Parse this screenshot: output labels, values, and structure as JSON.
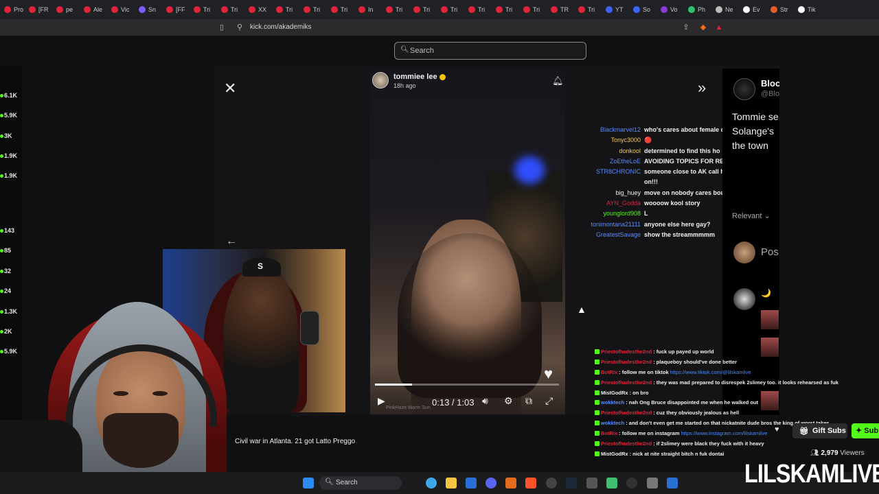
{
  "browser": {
    "tabs": [
      {
        "label": "Pro",
        "color": "#e0243a"
      },
      {
        "label": "[FR",
        "color": "#e0243a"
      },
      {
        "label": "pe",
        "color": "#e0243a"
      },
      {
        "label": "Ale",
        "color": "#e0243a"
      },
      {
        "label": "Vic",
        "color": "#e0243a"
      },
      {
        "label": "Sn",
        "color": "#7d5cff"
      },
      {
        "label": "[FF",
        "color": "#e0243a"
      },
      {
        "label": "Tri",
        "color": "#e0243a"
      },
      {
        "label": "Tri",
        "color": "#e0243a"
      },
      {
        "label": "XX",
        "color": "#e0243a"
      },
      {
        "label": "Tri",
        "color": "#e0243a"
      },
      {
        "label": "Tri",
        "color": "#e0243a"
      },
      {
        "label": "Tri",
        "color": "#e0243a"
      },
      {
        "label": "In",
        "color": "#e0243a"
      },
      {
        "label": "Tri",
        "color": "#e0243a"
      },
      {
        "label": "Tri",
        "color": "#e0243a"
      },
      {
        "label": "Tri",
        "color": "#e0243a"
      },
      {
        "label": "Tri",
        "color": "#e0243a"
      },
      {
        "label": "Tri",
        "color": "#e0243a"
      },
      {
        "label": "Tri",
        "color": "#e0243a"
      },
      {
        "label": "TR",
        "color": "#e0243a"
      },
      {
        "label": "Tri",
        "color": "#e0243a"
      },
      {
        "label": "YT",
        "color": "#3b64ff"
      },
      {
        "label": "So",
        "color": "#3b64ff"
      },
      {
        "label": "Vo",
        "color": "#8b3bd6"
      },
      {
        "label": "Ph",
        "color": "#2fbf71"
      },
      {
        "label": "Ne",
        "color": "#bbbbbb"
      },
      {
        "label": "Ev",
        "color": "#ffffff"
      },
      {
        "label": "Str",
        "color": "#e85a2a"
      },
      {
        "label": "Tik",
        "color": "#ffffff"
      }
    ],
    "url": "kick.com/akademiks"
  },
  "kick": {
    "search_placeholder": "Search",
    "sidebar_counts": [
      "6.1K",
      "5.9K",
      "3K",
      "1.9K",
      "1.9K",
      "143",
      "85",
      "32",
      "24",
      "1.3K",
      "2K",
      "5.9K"
    ],
    "caption": "Civil war in Atlanta. 21 got Latto Preggo",
    "gift_subs_label": "Gift Subs",
    "sub_label": "Sub",
    "viewers_count": "2,979",
    "viewers_label": "Viewers"
  },
  "video": {
    "username": "tommiee lee",
    "posted": "18h ago",
    "timecode": "0:13 / 1:03",
    "progress": 0.2,
    "watermark": "PinkHaze Warm Sun"
  },
  "xpost": {
    "name": "Bloc",
    "handle": "@Blo",
    "text": "Tommie se Solange's the town",
    "relevant": "Relevant",
    "post_label": "Pos"
  },
  "overlay_chat": [
    {
      "name": "Blackmarvel12",
      "color": "#5a8cff",
      "msg": "who's cares about female drama"
    },
    {
      "name": "Tonyc3000",
      "color": "#f2c94c",
      "msg": "🔴"
    },
    {
      "name": "donkool",
      "color": "#f2c94c",
      "msg": "determined to find this ho"
    },
    {
      "name": "ZoEtheLoE",
      "color": "#5a8cff",
      "msg": "AVOIDING TOPICS FOR REGULAR SHIT"
    },
    {
      "name": "STR8CHRONIC",
      "color": "#5a8cff",
      "msg": "someone close to AK call his ass to move tf"
    },
    {
      "name": "",
      "color": "#5a8cff",
      "msg": "on!!!"
    },
    {
      "name": "big_huey",
      "color": "#f2f2f2",
      "msg": "move on nobody cares bout the harlot gang"
    },
    {
      "name": "AYN_Godda",
      "color": "#e0243a",
      "msg": "woooow kool story"
    },
    {
      "name": "younglord908",
      "color": "#53fc18",
      "msg": "L"
    },
    {
      "name": "tonimontana21111",
      "color": "#5a8cff",
      "msg": "anyone else here gay?"
    },
    {
      "name": "GreatestSavage",
      "color": "#5a8cff",
      "msg": "show the streammmmm"
    }
  ],
  "kick_chat": [
    {
      "name": "Priestofhadesthe2nd",
      "color": "#e0243a",
      "msg": ": fuck up payed up world",
      "link": ""
    },
    {
      "name": "Priestofhadesthe2nd",
      "color": "#e0243a",
      "msg": ": plaqueboy should've done better",
      "link": ""
    },
    {
      "name": "BotRix",
      "color": "#e0243a",
      "msg": ": follow me on tiktok",
      "link": "https://www.tiktok.com/@lilskamlive"
    },
    {
      "name": "Priestofhadesthe2nd",
      "color": "#e0243a",
      "msg": ": they was mad prepared to disrespek 2slimey too. it looks rehearsed as fuk",
      "link": ""
    },
    {
      "name": "MistGodRx",
      "color": "#f2f2f2",
      "msg": ": on bro",
      "link": ""
    },
    {
      "name": "wokktech",
      "color": "#5a8cff",
      "msg": ": nah Ong Bruce disappointed me when he walked out",
      "link": ""
    },
    {
      "name": "Priestofhadesthe2nd",
      "color": "#e0243a",
      "msg": ": cuz they obviously jealous as hell",
      "link": ""
    },
    {
      "name": "wokktech",
      "color": "#5a8cff",
      "msg": ": and don't even get me started on that nickatnite dude bros the king of worst takes",
      "link": ""
    },
    {
      "name": "BotRix",
      "color": "#e0243a",
      "msg": ": follow me on instagram",
      "link": "https://www.instagram.com/lilskamlive"
    },
    {
      "name": "Priestofhadesthe2nd",
      "color": "#e0243a",
      "msg": ": if 2slimey were black they fuck with it heavy",
      "link": ""
    },
    {
      "name": "MistGodRx",
      "color": "#f2f2f2",
      "msg": ": nick at nite straight bitch n fuk dontai",
      "link": ""
    }
  ],
  "taskbar": {
    "search_label": "Search"
  },
  "branding": {
    "watermark": "LILSKAMLIVE"
  }
}
